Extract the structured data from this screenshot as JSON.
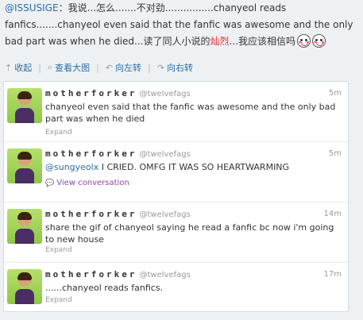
{
  "post": {
    "mention": "@ISSUSIGE",
    "text_a": "：我说...怎么.......不对劲................chanyeol reads fanfics.......chanyeol even said that the fanfic was awesome and the only bad part was when he died...读了同人小说的",
    "highlight": "灿烈",
    "text_b": "...我应该相信吗",
    "emojis": [
      "blush-face-icon",
      "blush-face-icon"
    ]
  },
  "toolbar": {
    "collapse": "收起",
    "view_large": "查看大图",
    "rotate_left": "向左转",
    "rotate_right": "向右转"
  },
  "tweets": [
    {
      "name": "motherforker",
      "handle": "@twelvefags",
      "time": "5m",
      "text": "chanyeol even said that the fanfic was awesome and the only bad part was when he died",
      "expand": "Expand"
    },
    {
      "name": "motherforker",
      "handle": "@twelvefags",
      "time": "5m",
      "mention": "@sungyeolx",
      "text": " I CRIED. OMFG IT WAS SO HEARTWARMING",
      "view_conversation": "View conversation"
    },
    {
      "name": "motherforker",
      "handle": "@twelvefags",
      "time": "14m",
      "text": "share the gif of chanyeol saying he read a fanfic bc now i'm going to new house",
      "expand": "Expand"
    },
    {
      "name": "motherforker",
      "handle": "@twelvefags",
      "time": "17m",
      "text": "......chanyeol reads fanfics.",
      "expand": "Expand"
    }
  ],
  "colors": {
    "link": "#2a6ea6",
    "highlight": "#e03030",
    "conversation": "#8e44ad",
    "meta": "#999999"
  }
}
